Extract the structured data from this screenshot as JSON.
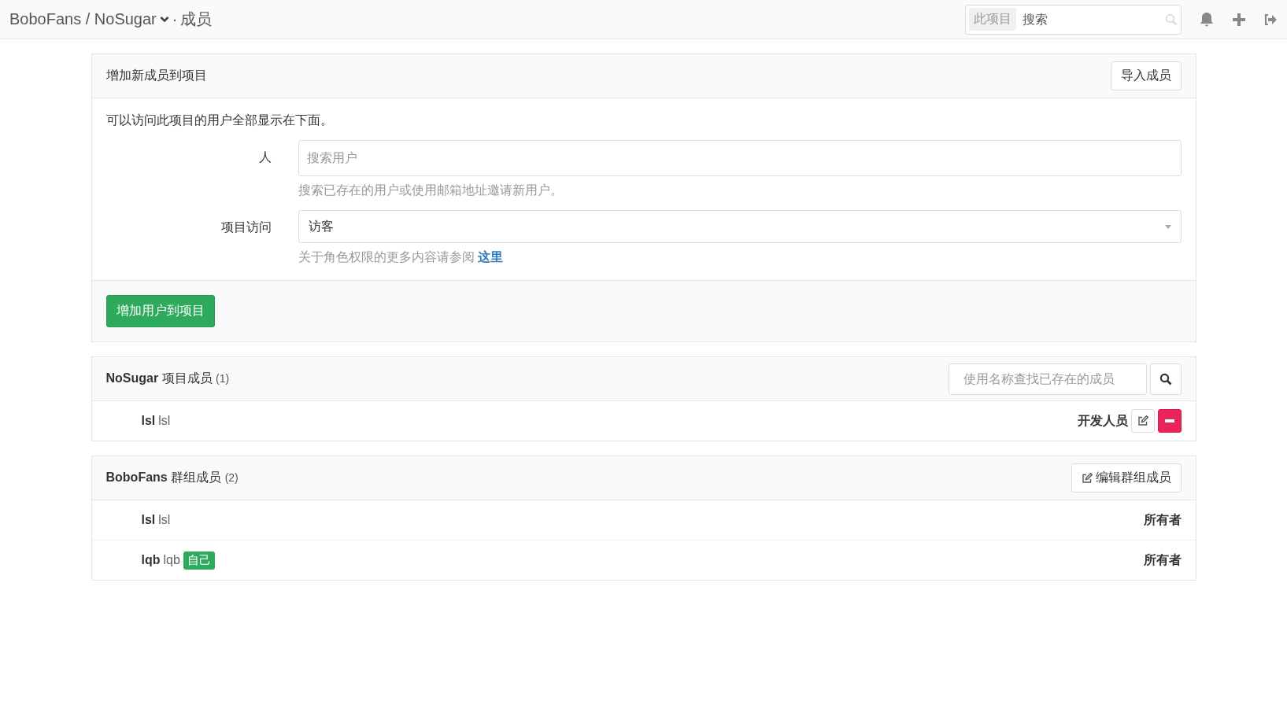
{
  "header": {
    "breadcrumb": "BoboFans / NoSugar",
    "separator": "·",
    "page": "成员",
    "search": {
      "scope": "此项目",
      "placeholder": "搜索"
    }
  },
  "add_panel": {
    "title": "增加新成员到项目",
    "import_button": "导入成员",
    "intro": "可以访问此项目的用户全部显示在下面。",
    "people": {
      "label": "人",
      "placeholder": "搜索用户",
      "help": "搜索已存在的用户或使用邮箱地址邀请新用户。"
    },
    "access": {
      "label": "项目访问",
      "value": "访客",
      "help": "关于角色权限的更多内容请参阅",
      "help_link": "这里"
    },
    "submit_button": "增加用户到项目"
  },
  "project_members": {
    "name": "NoSugar",
    "title": "项目成员",
    "count": "(1)",
    "search_placeholder": "使用名称查找已存在的成员",
    "members": [
      {
        "username": "lsl",
        "name": "lsl",
        "role": "开发人员"
      }
    ]
  },
  "group_members": {
    "name": "BoboFans",
    "title": "群组成员",
    "count": "(2)",
    "edit_button": "编辑群组成员",
    "members": [
      {
        "username": "lsl",
        "name": "lsl",
        "role": "所有者"
      },
      {
        "username": "lqb",
        "name": "lqb",
        "badge": "自己",
        "role": "所有者"
      }
    ]
  }
}
